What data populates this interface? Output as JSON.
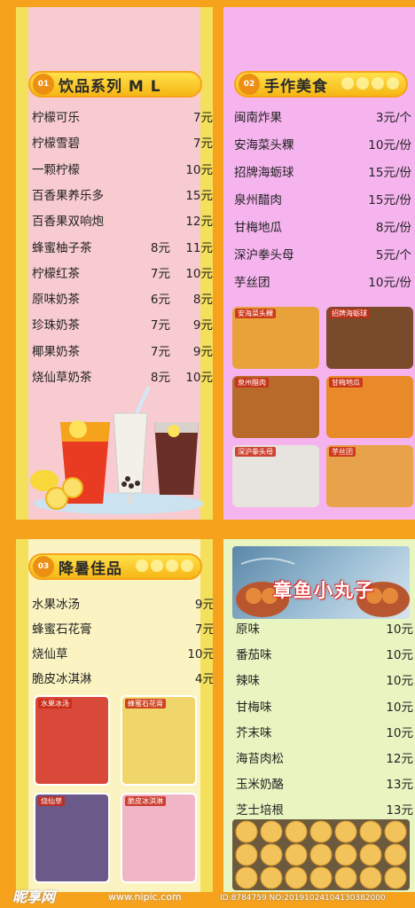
{
  "drinks": {
    "num": "01",
    "title": "饮品系列 M  L",
    "items": [
      {
        "name": "柠檬可乐",
        "m": "",
        "l": "7元"
      },
      {
        "name": "柠檬雪碧",
        "m": "",
        "l": "7元"
      },
      {
        "name": "一颗柠檬",
        "m": "",
        "l": "10元"
      },
      {
        "name": "百香果养乐多",
        "m": "",
        "l": "15元"
      },
      {
        "name": "百香果双响炮",
        "m": "",
        "l": "12元"
      },
      {
        "name": "蜂蜜柚子茶",
        "m": "8元",
        "l": "11元"
      },
      {
        "name": "柠檬红茶",
        "m": "7元",
        "l": "10元"
      },
      {
        "name": "原味奶茶",
        "m": "6元",
        "l": "8元"
      },
      {
        "name": "珍珠奶茶",
        "m": "7元",
        "l": "9元"
      },
      {
        "name": "椰果奶茶",
        "m": "7元",
        "l": "9元"
      },
      {
        "name": "烧仙草奶茶",
        "m": "8元",
        "l": "10元"
      }
    ]
  },
  "snacks": {
    "num": "02",
    "title": "手作美食",
    "items": [
      {
        "name": "闽南炸果",
        "price": "3元/个"
      },
      {
        "name": "安海菜头粿",
        "price": "10元/份"
      },
      {
        "name": "招牌海蛎球",
        "price": "15元/份"
      },
      {
        "name": "泉州醋肉",
        "price": "15元/份"
      },
      {
        "name": "甘梅地瓜",
        "price": "8元/份"
      },
      {
        "name": "深沪拳头母",
        "price": "5元/个"
      },
      {
        "name": "芋丝团",
        "price": "10元/份"
      }
    ],
    "photos": [
      "安海菜头粿",
      "招牌海蛎球",
      "泉州醋肉",
      "甘梅地瓜",
      "深沪拳头母",
      "芋丝团"
    ]
  },
  "summer": {
    "num": "03",
    "title": "降暑佳品",
    "items": [
      {
        "name": "水果冰汤",
        "price": "9元"
      },
      {
        "name": "蜂蜜石花膏",
        "price": "7元"
      },
      {
        "name": "烧仙草",
        "price": "10元"
      },
      {
        "name": "脆皮冰淇淋",
        "price": "4元"
      }
    ],
    "photos": [
      "水果冰汤",
      "蜂蜜石花膏",
      "烧仙草",
      "脆皮冰淇淋"
    ]
  },
  "octo": {
    "title": "章鱼小丸子",
    "items": [
      {
        "name": "原味",
        "price": "10元"
      },
      {
        "name": "番茄味",
        "price": "10元"
      },
      {
        "name": "辣味",
        "price": "10元"
      },
      {
        "name": "甘梅味",
        "price": "10元"
      },
      {
        "name": "芥末味",
        "price": "10元"
      },
      {
        "name": "海苔肉松",
        "price": "12元"
      },
      {
        "name": "玉米奶酪",
        "price": "13元"
      },
      {
        "name": "芝士培根",
        "price": "13元"
      }
    ]
  },
  "watermark": {
    "brand": "昵享网",
    "url": "www.nipic.com",
    "id": "ID:8784759 NO:20191024104130382000"
  },
  "colors": {
    "border": "#f6a21d",
    "drinks_bg": "#f8cbd0",
    "snacks_bg": "#f6b4ef",
    "summer_bg": "#fbf4c2",
    "octo_bg": "#e8f5c0"
  }
}
